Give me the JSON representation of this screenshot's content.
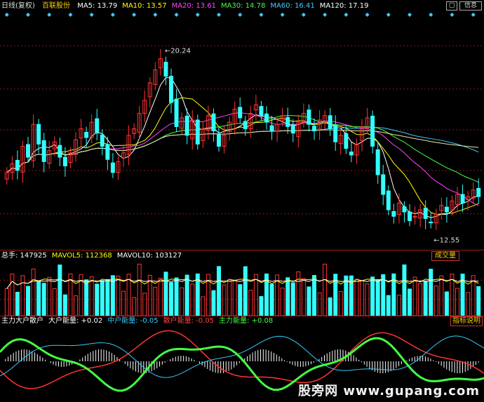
{
  "price_panel": {
    "period_label": "日线(复权)",
    "stock_name": "百联股份",
    "ma": [
      {
        "label": "MA5: 13.79",
        "color": "#ffffff"
      },
      {
        "label": "MA10: 13.57",
        "color": "#ffff00"
      },
      {
        "label": "MA20: 13.61",
        "color": "#ff44ff"
      },
      {
        "label": "MA30: 14.78",
        "color": "#44ff44"
      },
      {
        "label": "MA60: 16.41",
        "color": "#44c8ff"
      },
      {
        "label": "MA120: 17.19",
        "color": "#ffffff"
      }
    ],
    "high_label": "20.24",
    "low_label": "12.55",
    "colors": {
      "up": "#ff3333",
      "down": "#33ffff",
      "grid": "#8b1a1a"
    }
  },
  "volume_panel": {
    "labels": [
      {
        "text": "总手: 147925",
        "color": "#ffffff"
      },
      {
        "text": "MAVOL5: 112368",
        "color": "#ffff00"
      },
      {
        "text": "MAVOL10: 103127",
        "color": "#ffffff"
      }
    ],
    "tag": "成交量"
  },
  "indicator_panel": {
    "labels": [
      {
        "text": "主力大户散户",
        "color": "#ffffff"
      },
      {
        "text": "大户能量: +0.02",
        "color": "#ffffff"
      },
      {
        "text": "中户能量: -0.05",
        "color": "#33ccff"
      },
      {
        "text": "散户能量: -0.05",
        "color": "#ff4444"
      },
      {
        "text": "主力能量: +0.08",
        "color": "#44ff44"
      }
    ],
    "tag": "指标说明",
    "watermark": "股旁网 www.gupang.com"
  },
  "toolbar": {
    "close_glyph": "关",
    "icon_glyph": "信息"
  },
  "chart_data": {
    "type": "candlestick",
    "title": "百联股份",
    "ylim": [
      11.5,
      21.5
    ],
    "candles_close": [
      14.9,
      15.3,
      15.0,
      16.1,
      15.6,
      17.1,
      16.2,
      15.4,
      15.9,
      16.3,
      15.6,
      15.2,
      15.8,
      16.4,
      16.9,
      16.5,
      17.2,
      16.7,
      16.1,
      15.5,
      14.9,
      15.4,
      15.8,
      16.6,
      16.9,
      17.6,
      18.2,
      19.0,
      19.6,
      20.1,
      19.3,
      18.1,
      17.0,
      17.4,
      16.6,
      17.3,
      16.2,
      16.9,
      17.5,
      16.8,
      16.1,
      16.6,
      17.2,
      17.8,
      17.4,
      16.9,
      17.6,
      18.0,
      17.5,
      17.2,
      16.8,
      17.1,
      17.5,
      17.0,
      16.7,
      17.2,
      17.6,
      17.1,
      16.8,
      17.3,
      17.5,
      16.9,
      16.3,
      16.6,
      16.0,
      15.7,
      16.2,
      17.0,
      17.4,
      16.1,
      14.8,
      13.9,
      13.2,
      12.9,
      13.5,
      13.1,
      12.7,
      12.9,
      13.2,
      12.8,
      12.6,
      13.0,
      13.4,
      13.1,
      13.6,
      13.9,
      13.5,
      13.8,
      14.1,
      13.8
    ],
    "ma": {
      "MA5": 13.79,
      "MA10": 13.57,
      "MA20": 13.61,
      "MA30": 14.78,
      "MA60": 16.41,
      "MA120": 17.19
    },
    "volume": {
      "total": 147925,
      "MAVOL5": 112368,
      "MAVOL10": 103127
    },
    "indicator": {
      "大户能量": 0.02,
      "中户能量": -0.05,
      "散户能量": -0.05,
      "主力能量": 0.08
    }
  }
}
